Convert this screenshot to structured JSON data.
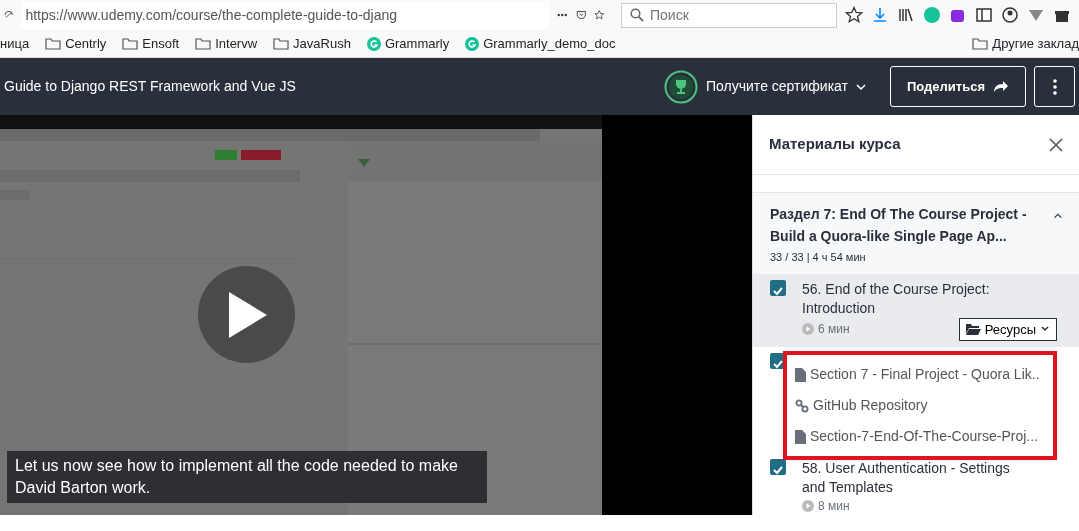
{
  "browser": {
    "url": "https://www.udemy.com/course/the-complete-guide-to-djang",
    "search": {
      "placeholder": "Поиск"
    },
    "bookmarks": [
      {
        "label": "ница",
        "kind": "text"
      },
      {
        "label": "Centrly",
        "kind": "folder"
      },
      {
        "label": "Ensoft",
        "kind": "folder"
      },
      {
        "label": "Intervw",
        "kind": "folder"
      },
      {
        "label": "JavaRush",
        "kind": "folder"
      },
      {
        "label": "Grammarly",
        "kind": "grammarly"
      },
      {
        "label": "Grammarly_demo_doc",
        "kind": "grammarly"
      }
    ],
    "other_bookmarks": "Другие заклад"
  },
  "header": {
    "course_title": "Guide to Django REST Framework and Vue JS",
    "certificate": "Получите сертификат",
    "share": "Поделиться"
  },
  "player": {
    "caption": "Let us now see how to implement all the code needed to make David Barton work."
  },
  "sidebar": {
    "title": "Материалы курса",
    "section": {
      "title": "Раздел 7: End Of The Course Project - Build a Quora-like Single Page Ap...",
      "meta": "33 / 33 | 4 ч 54 мин",
      "expanded": true
    },
    "lessons": [
      {
        "title": "56. End of the Course Project: Introduction",
        "duration": "6 мин",
        "checked": true,
        "current": true,
        "resources": "Ресурсы"
      },
      {
        "checked": true
      },
      {
        "title": "58. User Authentication - Settings and Templates",
        "duration": "8 мин",
        "checked": true,
        "current": false
      }
    ],
    "resources_menu": {
      "highlighted": true,
      "items": [
        {
          "label": "Section 7 - Final Project - Quora Lik..",
          "kind": "file"
        },
        {
          "label": "GitHub Repository",
          "kind": "link"
        },
        {
          "label": "Section-7-End-Of-The-Course-Proj...",
          "kind": "file"
        }
      ]
    }
  }
}
